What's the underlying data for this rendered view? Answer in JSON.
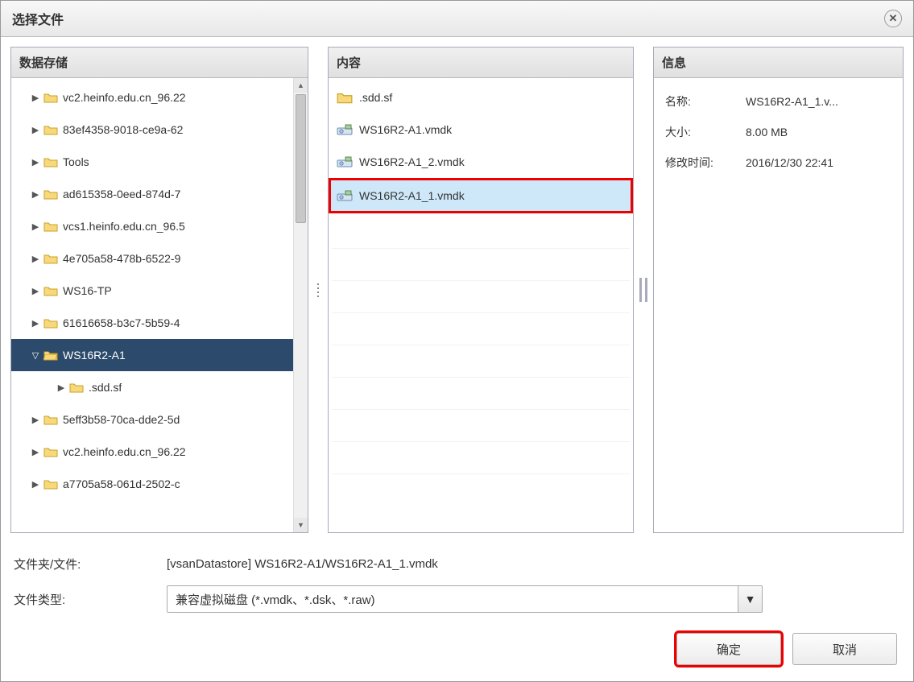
{
  "dialog": {
    "title": "选择文件"
  },
  "panels": {
    "datastore": {
      "title": "数据存储"
    },
    "content": {
      "title": "内容"
    },
    "info": {
      "title": "信息"
    }
  },
  "tree": {
    "items": [
      {
        "label": "vc2.heinfo.edu.cn_96.22",
        "expanded": false,
        "level": 0
      },
      {
        "label": "83ef4358-9018-ce9a-62",
        "expanded": false,
        "level": 0
      },
      {
        "label": "Tools",
        "expanded": false,
        "level": 0
      },
      {
        "label": "ad615358-0eed-874d-7",
        "expanded": false,
        "level": 0
      },
      {
        "label": "vcs1.heinfo.edu.cn_96.5",
        "expanded": false,
        "level": 0
      },
      {
        "label": "4e705a58-478b-6522-9",
        "expanded": false,
        "level": 0
      },
      {
        "label": "WS16-TP",
        "expanded": false,
        "level": 0
      },
      {
        "label": "61616658-b3c7-5b59-4",
        "expanded": false,
        "level": 0
      },
      {
        "label": "WS16R2-A1",
        "expanded": true,
        "selected": true,
        "level": 0
      },
      {
        "label": ".sdd.sf",
        "expanded": false,
        "level": 1
      },
      {
        "label": "5eff3b58-70ca-dde2-5d",
        "expanded": false,
        "level": 0
      },
      {
        "label": "vc2.heinfo.edu.cn_96.22",
        "expanded": false,
        "level": 0
      },
      {
        "label": "a7705a58-061d-2502-c",
        "expanded": false,
        "level": 0
      }
    ]
  },
  "content_list": [
    {
      "name": ".sdd.sf",
      "type": "folder"
    },
    {
      "name": "WS16R2-A1.vmdk",
      "type": "disk"
    },
    {
      "name": "WS16R2-A1_2.vmdk",
      "type": "disk"
    },
    {
      "name": "WS16R2-A1_1.vmdk",
      "type": "disk",
      "highlighted": true
    }
  ],
  "info": {
    "name_label": "名称:",
    "name_value": "WS16R2-A1_1.v...",
    "size_label": "大小:",
    "size_value": "8.00 MB",
    "mtime_label": "修改时间:",
    "mtime_value": "2016/12/30 22:41"
  },
  "footer": {
    "path_label": "文件夹/文件:",
    "path_value": "[vsanDatastore] WS16R2-A1/WS16R2-A1_1.vmdk",
    "type_label": "文件类型:",
    "type_value": "兼容虚拟磁盘 (*.vmdk、*.dsk、*.raw)"
  },
  "buttons": {
    "ok": "确定",
    "cancel": "取消"
  }
}
